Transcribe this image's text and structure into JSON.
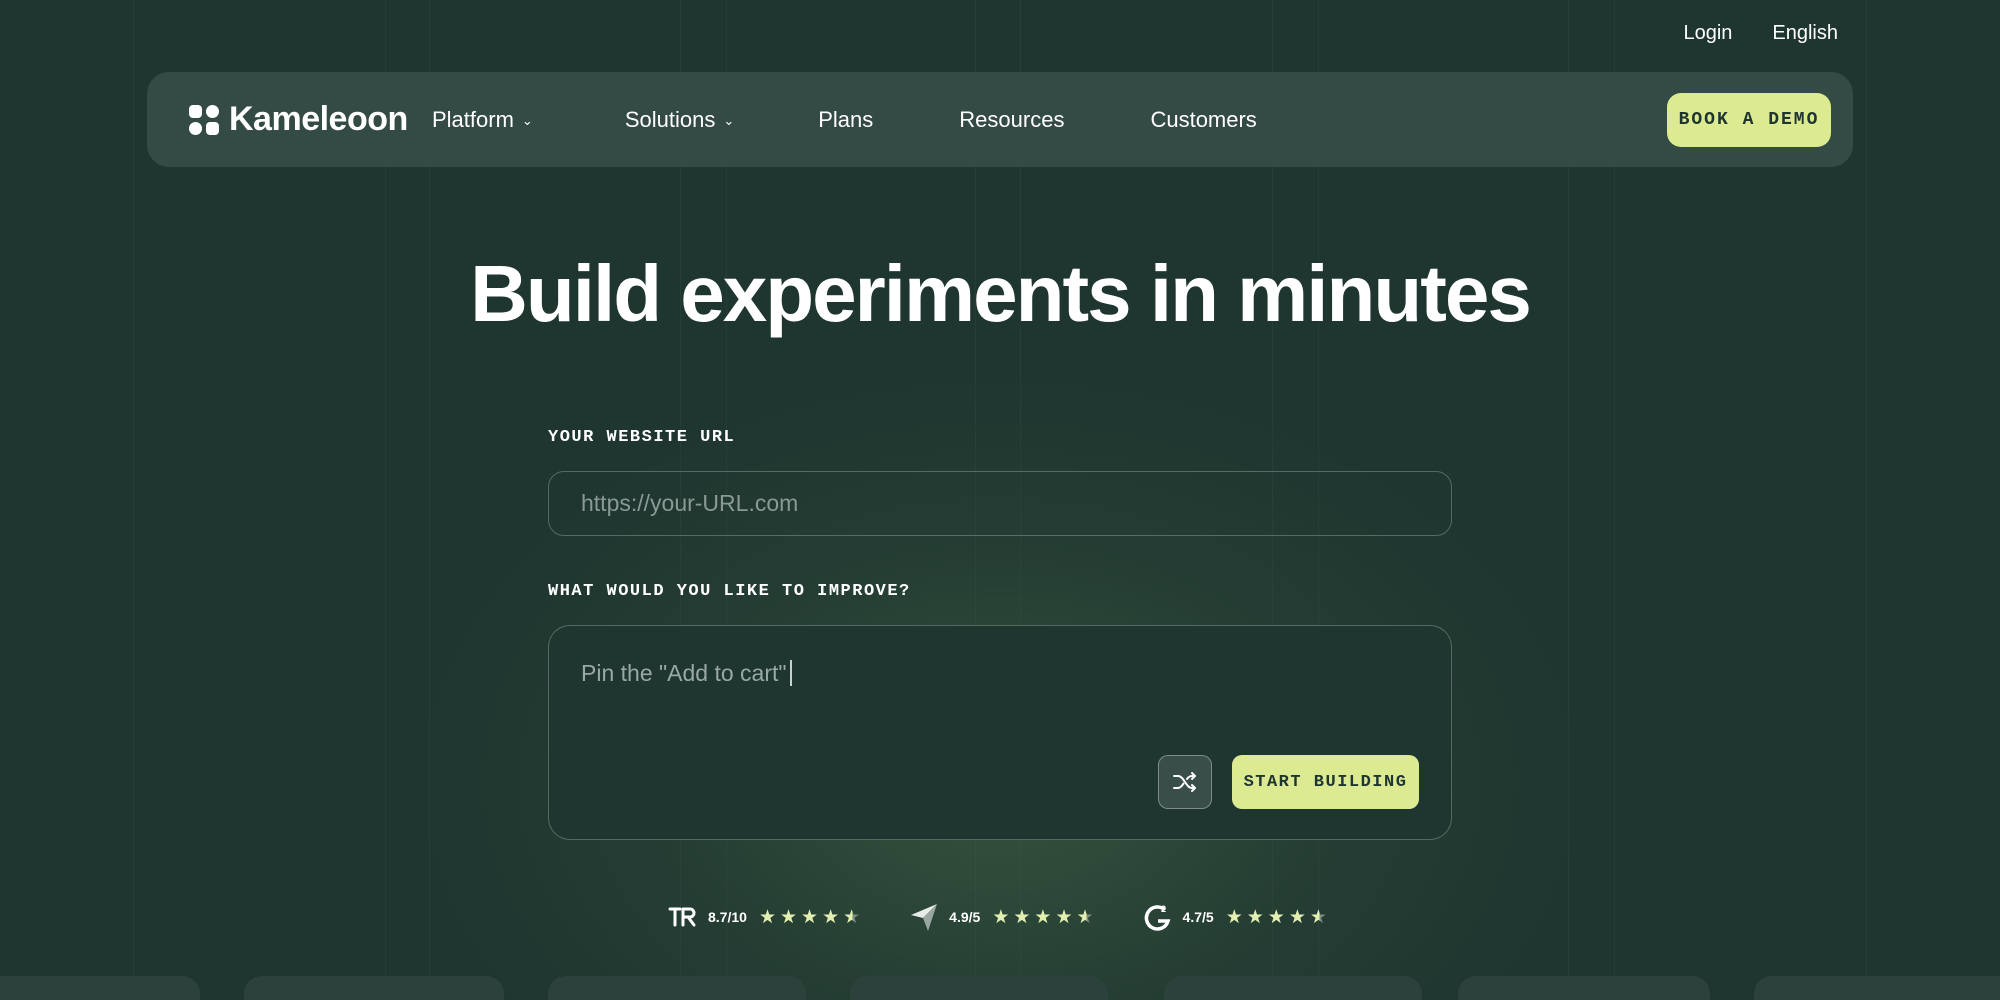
{
  "topbar": {
    "login": "Login",
    "language": "English"
  },
  "nav": {
    "logo_text": "Kameleoon",
    "items": [
      {
        "label": "Platform",
        "has_dropdown": true
      },
      {
        "label": "Solutions",
        "has_dropdown": true
      },
      {
        "label": "Plans",
        "has_dropdown": false
      },
      {
        "label": "Resources",
        "has_dropdown": false
      },
      {
        "label": "Customers",
        "has_dropdown": false
      }
    ],
    "cta": "BOOK A DEMO"
  },
  "hero": {
    "title": "Build experiments in minutes"
  },
  "form": {
    "url_label": "YOUR WEBSITE URL",
    "url_placeholder": "https://your-URL.com",
    "improve_label": "WHAT WOULD YOU LIKE TO IMPROVE?",
    "improve_text": "Pin the \"Add to cart\"",
    "shuffle_icon": "shuffle-icon",
    "start_button": "START BUILDING"
  },
  "ratings": [
    {
      "source_icon": "trustradius-logo-icon",
      "score": "8.7/10",
      "stars": 4.5
    },
    {
      "source_icon": "capterra-logo-icon",
      "score": "4.9/5",
      "stars": 4.5
    },
    {
      "source_icon": "g2-logo-icon",
      "score": "4.7/5",
      "stars": 4.5
    }
  ],
  "colors": {
    "background": "#1f3530",
    "navbar": "#344a45",
    "accent": "#dcea92",
    "star": "#e3efb1"
  }
}
